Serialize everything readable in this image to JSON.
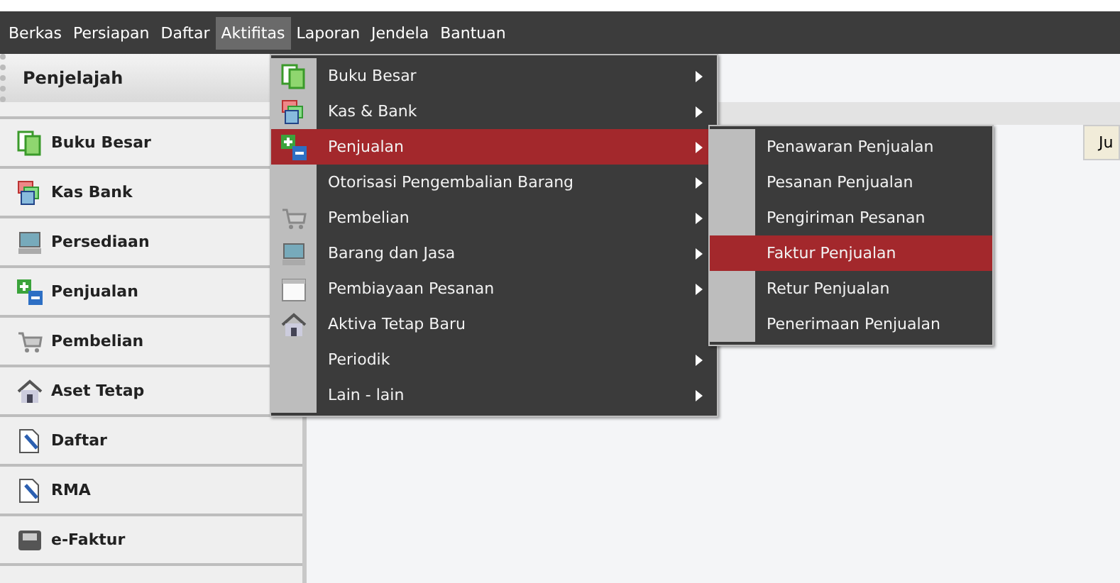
{
  "menubar": [
    {
      "label": "Berkas",
      "selected": false
    },
    {
      "label": "Persiapan",
      "selected": false
    },
    {
      "label": "Daftar",
      "selected": false
    },
    {
      "label": "Aktifitas",
      "selected": true
    },
    {
      "label": "Laporan",
      "selected": false
    },
    {
      "label": "Jendela",
      "selected": false
    },
    {
      "label": "Bantuan",
      "selected": false
    }
  ],
  "sidebar": {
    "title": "Penjelajah",
    "items": [
      {
        "label": "Buku Besar",
        "kind": "ledger"
      },
      {
        "label": "Kas Bank",
        "kind": "bank"
      },
      {
        "label": "Persediaan",
        "kind": "computer"
      },
      {
        "label": "Penjualan",
        "kind": "plusminus"
      },
      {
        "label": "Pembelian",
        "kind": "cart"
      },
      {
        "label": "Aset Tetap",
        "kind": "house"
      },
      {
        "label": "Daftar",
        "kind": "document"
      },
      {
        "label": "RMA",
        "kind": "document"
      },
      {
        "label": "e-Faktur",
        "kind": "device"
      }
    ]
  },
  "table": {
    "columns": [
      "Ju"
    ]
  },
  "menu": {
    "items": [
      {
        "label": "Buku Besar",
        "kind": "ledger",
        "submenu": true,
        "selected": false
      },
      {
        "label": "Kas & Bank",
        "kind": "bank",
        "submenu": true,
        "selected": false
      },
      {
        "label": "Penjualan",
        "kind": "plusminus",
        "submenu": true,
        "selected": true
      },
      {
        "label": "Otorisasi Pengembalian Barang",
        "kind": "plain",
        "submenu": true,
        "selected": false
      },
      {
        "label": "Pembelian",
        "kind": "cart",
        "submenu": true,
        "selected": false
      },
      {
        "label": "Barang dan Jasa",
        "kind": "computer",
        "submenu": true,
        "selected": false
      },
      {
        "label": "Pembiayaan Pesanan",
        "kind": "calendar",
        "submenu": true,
        "selected": false
      },
      {
        "label": "Aktiva Tetap Baru",
        "kind": "house",
        "submenu": false,
        "selected": false
      },
      {
        "label": "Periodik",
        "kind": "plain",
        "submenu": true,
        "selected": false
      },
      {
        "label": "Lain - lain",
        "kind": "plain",
        "submenu": true,
        "selected": false
      }
    ]
  },
  "submenu": {
    "items": [
      {
        "label": "Penawaran Penjualan",
        "selected": false
      },
      {
        "label": "Pesanan Penjualan",
        "selected": false
      },
      {
        "label": "Pengiriman Pesanan",
        "selected": false
      },
      {
        "label": "Faktur Penjualan",
        "selected": true
      },
      {
        "label": "Retur Penjualan",
        "selected": false
      },
      {
        "label": "Penerimaan Penjualan",
        "selected": false
      }
    ]
  }
}
